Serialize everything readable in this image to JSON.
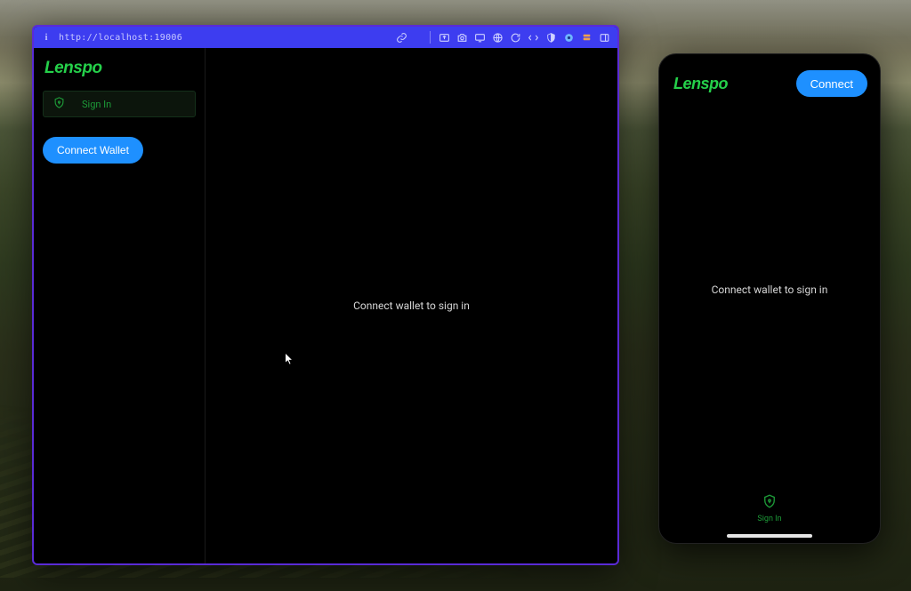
{
  "colors": {
    "accent_blue": "#1e90ff",
    "brand_green": "#25d04a",
    "urlbar_blue": "#3d3df0",
    "window_border": "#5a2bd6"
  },
  "browser": {
    "url": "http://localhost:19006",
    "toolbar_icons": [
      "link-icon",
      "upload-icon",
      "camera-icon",
      "screen-icon",
      "globe-icon",
      "refresh-icon",
      "sync-icon",
      "shield-half-icon",
      "disc-icon",
      "stack-icon",
      "panel-icon"
    ]
  },
  "app": {
    "brand": "Lenspo",
    "sidebar": {
      "signin_label": "Sign In",
      "connect_label": "Connect Wallet"
    },
    "main_message": "Connect wallet to sign in"
  },
  "mobile": {
    "brand": "Lenspo",
    "connect_label": "Connect",
    "main_message": "Connect wallet to sign in",
    "nav": {
      "signin_label": "Sign In"
    }
  }
}
